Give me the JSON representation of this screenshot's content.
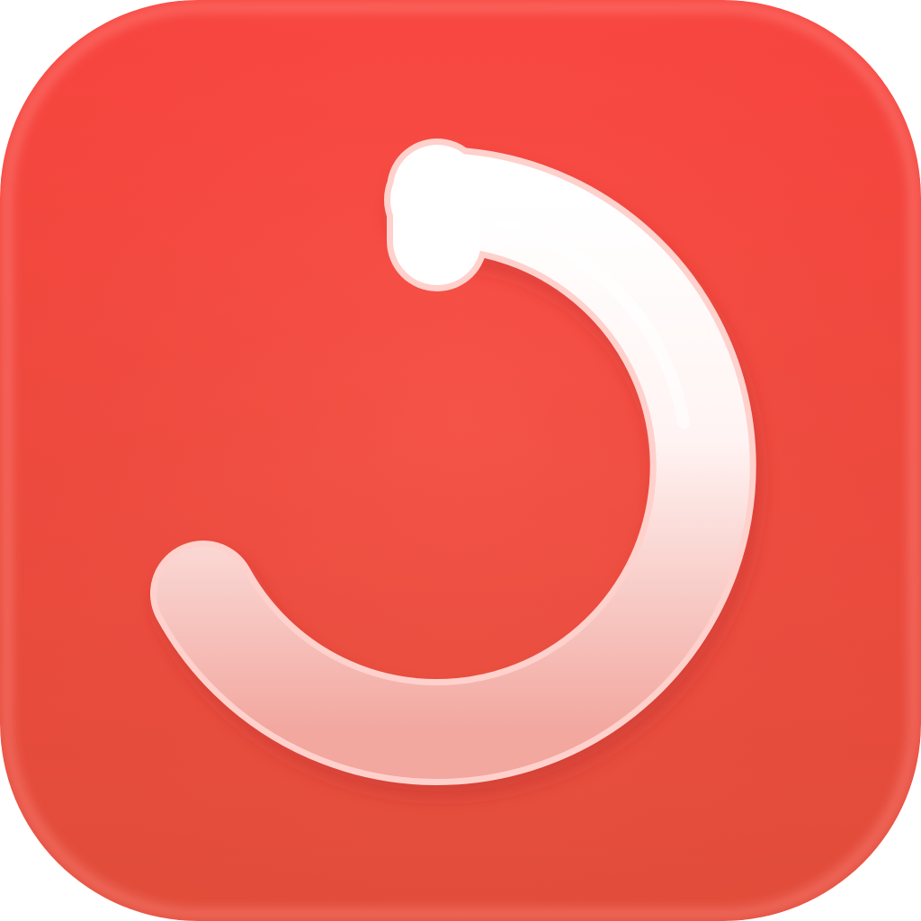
{
  "app_icon": {
    "name": "red-rounded-square-icon-with-white-arc",
    "glyph": "circular-arc-icon",
    "colors": {
      "tile_top": "#FF4640",
      "tile_bottom": "#E84F3C",
      "tile_rim": "#FF8A84",
      "arc_top": "#FFFFFF",
      "arc_bottom": "#F2A79F",
      "arc_outline": "#FFD1CC",
      "arc_shadow": "#B82A24"
    }
  }
}
